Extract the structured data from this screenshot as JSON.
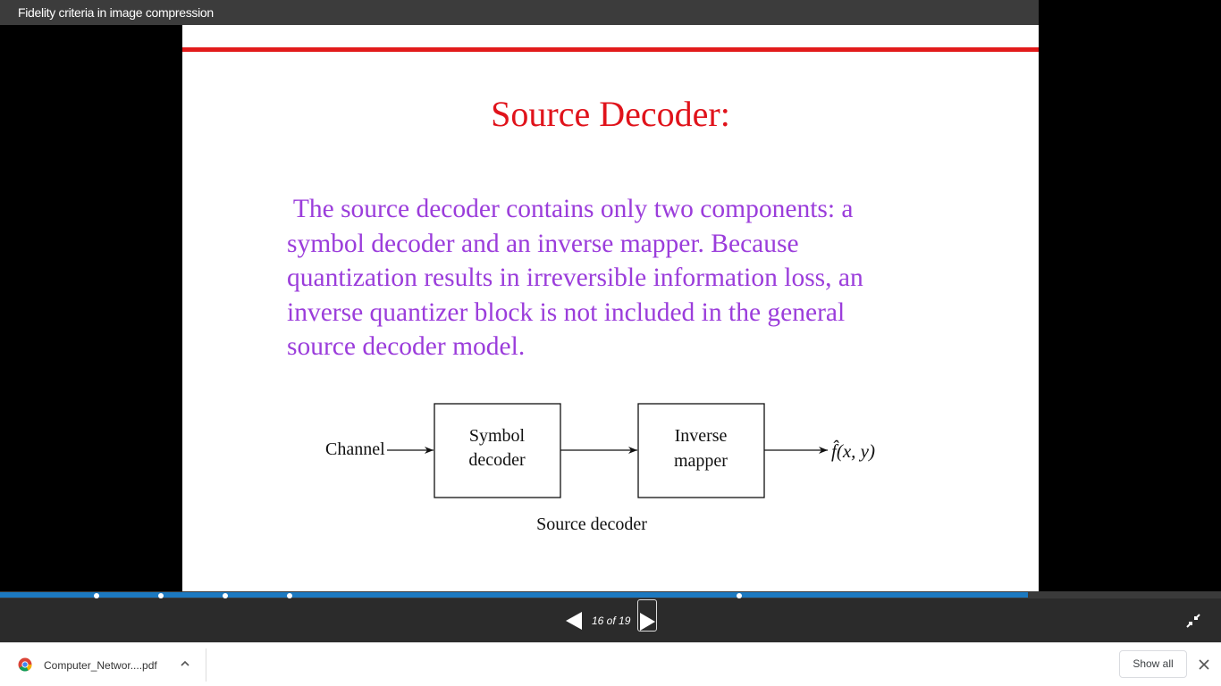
{
  "window": {
    "title": "Fidelity criteria in image compression"
  },
  "slide": {
    "title": "Source Decoder:",
    "body_lines": [
      " The source decoder contains only two components: a",
      "symbol decoder and an inverse mapper. Because",
      "quantization results in irreversible information loss, an",
      "inverse quantizer block is not included in the general",
      "source decoder model."
    ],
    "diagram": {
      "input_label": "Channel",
      "block1": [
        "Symbol",
        "decoder"
      ],
      "block2": [
        "Inverse",
        "mapper"
      ],
      "output_label": "f̂(x, y)",
      "caption": "Source decoder"
    }
  },
  "viewer": {
    "page_indicator": "16 of 19",
    "progress_fraction": 0.842,
    "prev_icon": "triangle-left-icon",
    "next_icon": "triangle-right-icon",
    "exit_fullscreen_icon": "exit-fullscreen-icon"
  },
  "downloads": {
    "file_name": "Computer_Networ....pdf",
    "show_all_label": "Show all",
    "browser_icon": "chrome-icon",
    "chevron_icon": "chevron-up-icon",
    "close_icon": "close-icon"
  },
  "colors": {
    "title_red": "#e0131b",
    "body_purple": "#9b3ddb",
    "progress_blue": "#1c79c0"
  }
}
